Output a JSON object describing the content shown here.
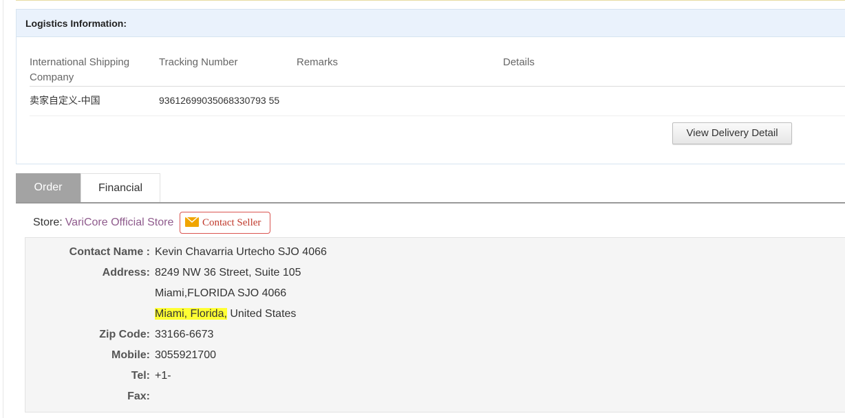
{
  "logistics": {
    "title": "Logistics Information:",
    "columns": [
      "International Shipping Company",
      "Tracking Number",
      "Remarks",
      "Details"
    ],
    "rows": [
      {
        "company": "卖家自定义-中国",
        "tracking": "93612699035068330793 55",
        "remarks": "",
        "details": ""
      }
    ],
    "view_delivery_label": "View Delivery Detail"
  },
  "tabs": [
    {
      "label": "Order",
      "active": true
    },
    {
      "label": "Financial",
      "active": false
    }
  ],
  "store": {
    "label": "Store:",
    "name": "VariCore Official Store",
    "contact_label": "Contact Seller"
  },
  "address": {
    "contact_name_label": "Contact Name :",
    "contact_name": "Kevin Chavarria Urtecho SJO 4066",
    "address_label": "Address:",
    "line1": "8249 NW 36 Street, Suite 105",
    "line2": "Miami,FLORIDA SJO 4066",
    "line3_highlight": "Miami, Florida,",
    "line3_rest": " United States",
    "zip_label": "Zip Code:",
    "zip": "33166-6673",
    "mobile_label": "Mobile:",
    "mobile": "3055921700",
    "tel_label": "Tel:",
    "tel": "+1-",
    "fax_label": "Fax:",
    "fax": ""
  },
  "colors": {
    "header_bg": "#eaf2fc",
    "active_tab": "#a3a3a3",
    "store_link": "#8e5a8c",
    "contact_seller": "#c0392b",
    "highlight": "#ffff33"
  }
}
